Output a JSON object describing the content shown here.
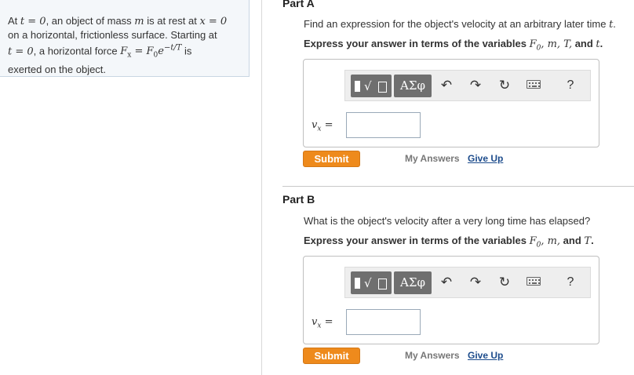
{
  "problem": {
    "line1_a": "At ",
    "line1_b": ", an object of mass ",
    "line1_c": " is at rest at ",
    "line2": "on a horizontal, frictionless surface. Starting at",
    "line3_a": ", a horizontal force ",
    "line3_b": " is",
    "line4": "exerted on the object.",
    "math": {
      "t0": "t = 0",
      "m": "m",
      "x0": "x = 0",
      "t0b": "t = 0",
      "force_lhs": "F",
      "force_sub": "x",
      "force_eq": " = F",
      "force_sub0": "0",
      "force_e": "e",
      "force_exp": "−t/T"
    }
  },
  "part_a": {
    "title": "Part A",
    "question_a": "Find an expression for the object's velocity at an arbitrary later time ",
    "question_var": "t",
    "question_end": ".",
    "instruction_a": "Express your answer in terms of the variables ",
    "instruction_vars_a": "F",
    "instruction_sub": "0",
    "instruction_vars_b": ", m, T,",
    "instruction_and": " and ",
    "instruction_vars_c": "t",
    "instruction_end": ".",
    "var_label": "v",
    "var_sub": "x",
    "var_eq": " =",
    "input_value": "",
    "submit_label": "Submit",
    "my_answers_label": "My Answers",
    "give_up_label": "Give Up"
  },
  "part_b": {
    "title": "Part B",
    "question": "What is the object's velocity after a very long time has elapsed?",
    "instruction_a": "Express your answer in terms of the variables ",
    "instruction_vars_a": "F",
    "instruction_sub": "0",
    "instruction_vars_b": ", m,",
    "instruction_and": " and ",
    "instruction_vars_c": "T",
    "instruction_end": ".",
    "var_label": "v",
    "var_sub": "x",
    "var_eq": " =",
    "input_value": "",
    "submit_label": "Submit",
    "my_answers_label": "My Answers",
    "give_up_label": "Give Up"
  },
  "toolbar": {
    "template_icon": "fraction-sqrt-template-icon",
    "greek_label": "ΑΣφ",
    "undo_icon": "undo-icon",
    "redo_icon": "redo-icon",
    "reset_icon": "reset-icon",
    "keyboard_icon": "keyboard-icon",
    "help_label": "?"
  },
  "colors": {
    "submit": "#ee8a1c",
    "give_up_link": "#1d4c8c",
    "toolbar_button": "#6f6f6f",
    "problem_panel_bg": "#f4f7fa"
  }
}
